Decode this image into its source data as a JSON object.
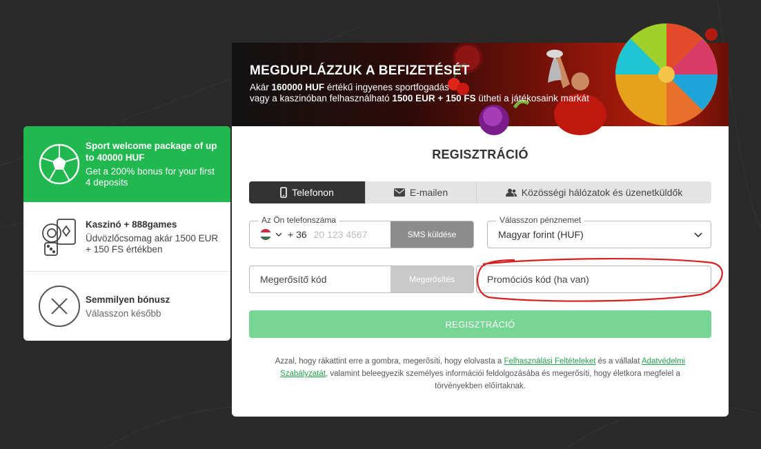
{
  "banner": {
    "title": "MEGDUPLÁZZUK A BEFIZETÉSÉT",
    "line1_prefix": "Akár ",
    "line1_bold": "160000 HUF",
    "line1_suffix": " értékű ingyenes sportfogadás",
    "line2_prefix": "vagy a kaszinóban felhasználható ",
    "line2_bold": "1500 EUR + 150 FS",
    "line2_suffix": " ütheti a játékosaink markát"
  },
  "bonuses": [
    {
      "title": "Sport welcome package of up to 40000 HUF",
      "desc": "Get a 200% bonus for your first 4 deposits",
      "icon": "soccer-ball-icon",
      "selected": true
    },
    {
      "title": "Kaszinó + 888games",
      "desc": "Üdvözlőcsomag akár 1500 EUR + 150 FS értékben",
      "icon": "casino-chips-cards-icon",
      "selected": false
    },
    {
      "title": "Semmilyen bónusz",
      "desc": "Válasszon később",
      "icon": "close-circle-icon",
      "selected": false
    }
  ],
  "form": {
    "title": "REGISZTRÁCIÓ",
    "tabs": [
      {
        "label": "Telefonon",
        "icon": "phone-icon",
        "active": true
      },
      {
        "label": "E-mailen",
        "icon": "envelope-icon",
        "active": false
      },
      {
        "label": "Közösségi hálózatok és üzenetküldők",
        "icon": "users-icon",
        "active": false
      }
    ],
    "phone_label": "Az Ön telefonszáma",
    "phone_prefix": "+ 36",
    "phone_placeholder": "20 123 4567",
    "sms_button": "SMS küldése",
    "currency_label": "Válasszon pénznemet",
    "currency_value": "Magyar forint (HUF)",
    "code_placeholder": "Megerősítő kód",
    "confirm_button": "Megerősítés",
    "promo_placeholder": "Promóciós kód (ha van)",
    "submit": "REGISZTRÁCIÓ",
    "legal_1": "Azzal, hogy rákattint erre a gombra, megerősíti, hogy elolvasta a ",
    "legal_link1": "Felhasználási Feltételeket",
    "legal_2": " és a vállalat ",
    "legal_link2": "Adatvédelmi Szabályzatát",
    "legal_3": ", valamint beleegyezik személyes információi feldolgozásába és megerősíti, hogy életkora megfelel a törvényekben előírtaknak."
  },
  "colors": {
    "accent": "#21b850",
    "annotation": "#d81e1e",
    "tab_active": "#333333"
  }
}
